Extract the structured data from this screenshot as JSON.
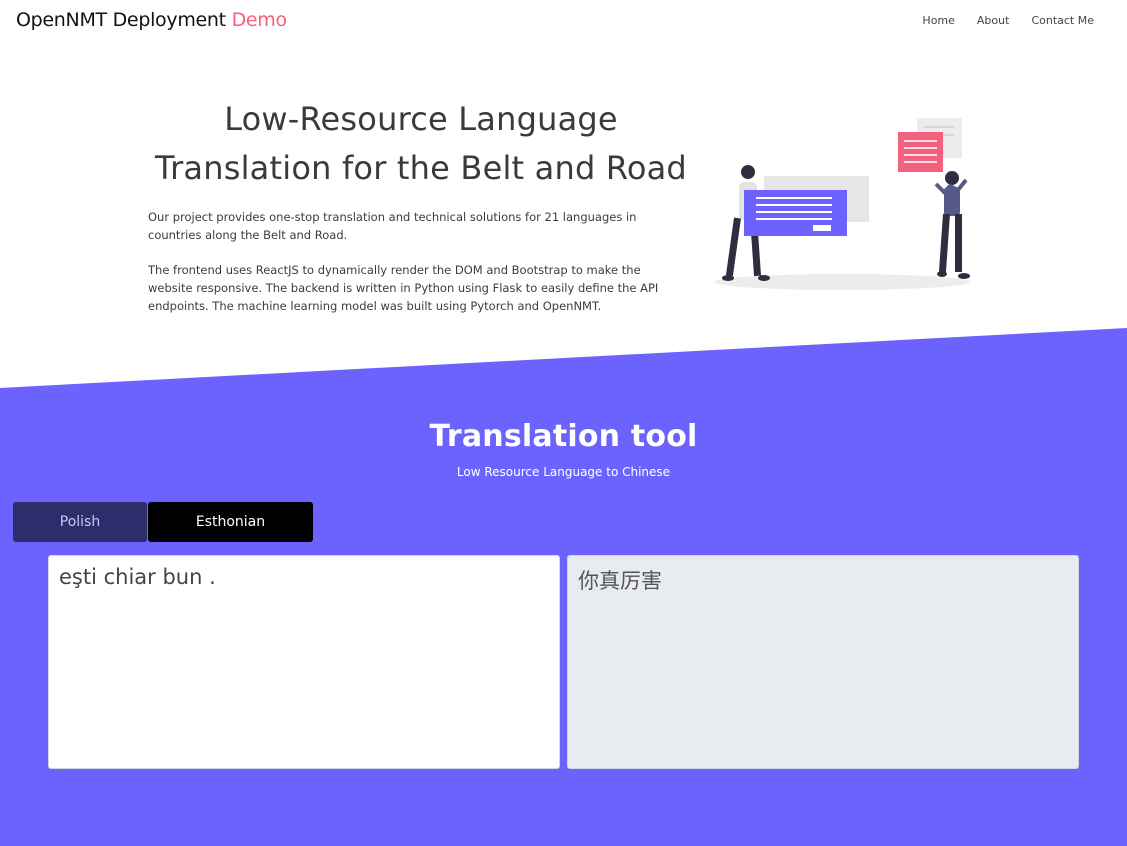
{
  "navbar": {
    "brand": "OpenNMT Deployment",
    "brand_accent": "Demo",
    "links": [
      "Home",
      "About",
      "Contact Me"
    ]
  },
  "hero": {
    "title_line1": "Low-Resource Language",
    "title_line2": "Translation for the Belt and Road",
    "paragraph1": "Our project provides one-stop translation and technical solutions for 21 languages in countries along the Belt and Road.",
    "paragraph2": "The frontend uses ReactJS to dynamically render the DOM and Bootstrap to make the website responsive. The backend is written in Python using Flask to easily define the API endpoints. The machine learning model was built using Pytorch and OpenNMT."
  },
  "tool": {
    "title": "Translation tool",
    "subtitle": "Low Resource Language to Chinese",
    "tabs": [
      "Polish",
      "Esthonian"
    ],
    "source_text": "eşti chiar bun .",
    "target_text": "你真厉害"
  },
  "colors": {
    "accent": "#f4617f",
    "purple": "#6c63ff",
    "tab_active": "#2e2d6b",
    "tab_inactive": "#000000",
    "output_bg": "#e8ebef"
  }
}
